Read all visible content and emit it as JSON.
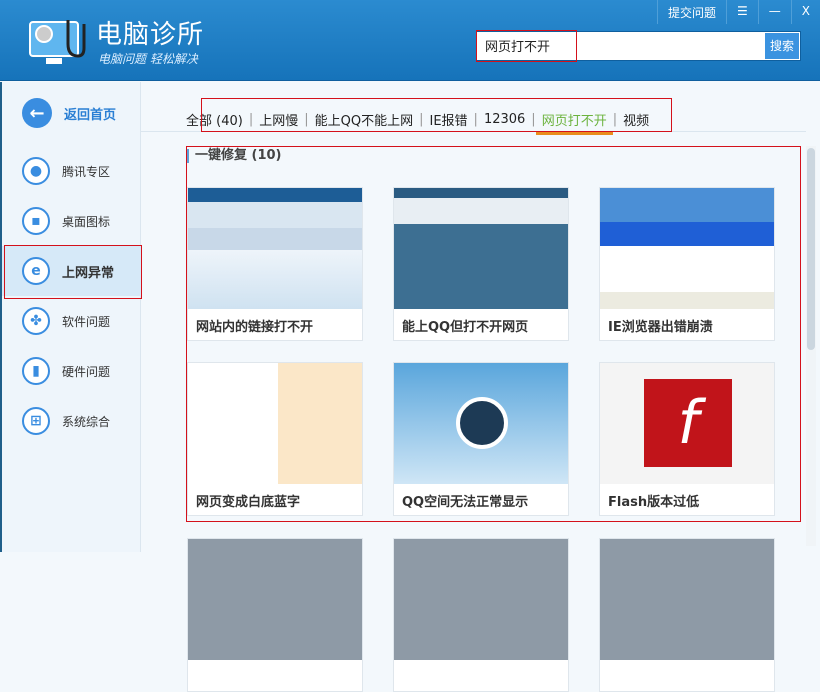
{
  "header": {
    "title": "电脑诊所",
    "slogan": "电脑问题 轻松解决",
    "submit_issue": "提交问题",
    "menu_icon": "menu-icon",
    "minimize": "—",
    "close": "X"
  },
  "search": {
    "value": "网页打不开",
    "button": "搜索"
  },
  "sidebar": {
    "back": "返回首页",
    "items": [
      {
        "label": "腾讯专区",
        "icon": "qq-penguin-icon"
      },
      {
        "label": "桌面图标",
        "icon": "monitor-icon"
      },
      {
        "label": "上网异常",
        "icon": "ie-icon",
        "active": true
      },
      {
        "label": "软件问题",
        "icon": "clover-icon"
      },
      {
        "label": "硬件问题",
        "icon": "pc-tower-icon"
      },
      {
        "label": "系统综合",
        "icon": "windows-icon"
      }
    ]
  },
  "tabs": [
    {
      "label": "全部 (40)"
    },
    {
      "label": "上网慢"
    },
    {
      "label": "能上QQ不能上网"
    },
    {
      "label": "IE报错"
    },
    {
      "label": "12306"
    },
    {
      "label": "网页打不开",
      "active": true
    },
    {
      "label": "视频"
    }
  ],
  "section": {
    "title": "一键修复 (10)"
  },
  "cards": [
    {
      "label": "网站内的链接打不开"
    },
    {
      "label": "能上QQ但打不开网页"
    },
    {
      "label": "IE浏览器出错崩溃"
    },
    {
      "label": "网页变成白底蓝字"
    },
    {
      "label": "QQ空间无法正常显示"
    },
    {
      "label": "Flash版本过低"
    }
  ],
  "colors": {
    "header": "#1a7cc4",
    "accent": "#3a8de0",
    "active_tab": "#6cb33e",
    "annotation": "#d4111b"
  }
}
